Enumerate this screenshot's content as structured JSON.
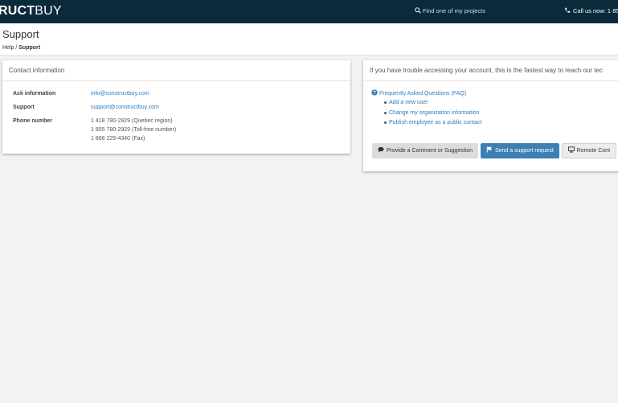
{
  "topbar": {
    "logo_bold": "RUCT",
    "logo_light": "BUY",
    "search_label": "Find one of my projects",
    "call_label": "Call us now: 1 85"
  },
  "header": {
    "title": "Support",
    "breadcrumb": {
      "parent": "Help",
      "separator": " / ",
      "current": "Support"
    }
  },
  "contact_card": {
    "title": "Contact information",
    "rows": {
      "ask": {
        "label": "Ask information",
        "value": "info@constructbuy.com"
      },
      "support": {
        "label": "Support",
        "value": "support@constructbuy.com"
      },
      "phone": {
        "label": "Phone number",
        "lines": [
          "1 418 780-2929 (Quebec region)",
          "1 855 780-2929 (Toll-free number)",
          "1 866 229-4340 (Fax)"
        ]
      }
    }
  },
  "help_card": {
    "intro": "If you have trouble accessing your account, this is the fastest way to reach our tec",
    "faq_title": "Frequently Asked Questions (FAQ)",
    "faq_items": [
      "Add a new user",
      "Change my organization information",
      "Publish employee as a public contact"
    ],
    "buttons": {
      "comment": "Provide a Comment or Suggestion",
      "support": "Send a support request",
      "remote": "Remote Cont"
    }
  },
  "colors": {
    "topbar": "#0b2a3c",
    "link": "#2f7bb8",
    "primary_button": "#3b7fb5",
    "background": "#f2f2f2"
  },
  "icons": [
    "search-icon",
    "phone-icon",
    "question-circle-icon",
    "comment-icon",
    "flag-icon",
    "monitor-icon"
  ]
}
